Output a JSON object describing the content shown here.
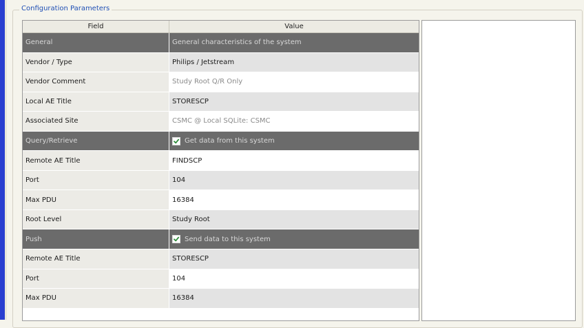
{
  "group": {
    "title": "Configuration Parameters"
  },
  "table": {
    "headers": {
      "field": "Field",
      "value": "Value"
    },
    "rows": [
      {
        "field": "General",
        "value": "General characteristics of the system",
        "type": "section",
        "checkbox": false
      },
      {
        "field": "Vendor / Type",
        "value": "Philips / Jetstream",
        "type": "grey",
        "muted": false
      },
      {
        "field": "Vendor Comment",
        "value": "Study Root Q/R Only",
        "type": "white",
        "muted": true
      },
      {
        "field": "Local AE Title",
        "value": "STORESCP",
        "type": "grey",
        "muted": false
      },
      {
        "field": "Associated Site",
        "value": "CSMC @ Local SQLite: CSMC",
        "type": "white",
        "muted": true
      },
      {
        "field": "Query/Retrieve",
        "value": "Get data from this system",
        "type": "section",
        "checkbox": true
      },
      {
        "field": "Remote AE Title",
        "value": "FINDSCP",
        "type": "white",
        "muted": false
      },
      {
        "field": "Port",
        "value": "104",
        "type": "grey",
        "muted": false
      },
      {
        "field": "Max PDU",
        "value": "16384",
        "type": "white",
        "muted": false
      },
      {
        "field": "Root Level",
        "value": "Study Root",
        "type": "grey",
        "muted": false
      },
      {
        "field": "Push",
        "value": "Send data to this system",
        "type": "section",
        "checkbox": true
      },
      {
        "field": "Remote AE Title",
        "value": "STORESCP",
        "type": "grey",
        "muted": false
      },
      {
        "field": "Port",
        "value": "104",
        "type": "white",
        "muted": false
      },
      {
        "field": "Max PDU",
        "value": "16384",
        "type": "grey",
        "muted": false
      }
    ]
  },
  "colors": {
    "accent_bar": "#2a3fd0",
    "section_row_bg": "#6b6b6b",
    "legend_text": "#1f4fb5"
  },
  "icons": {
    "checkbox": "checkbox-checked-icon"
  }
}
